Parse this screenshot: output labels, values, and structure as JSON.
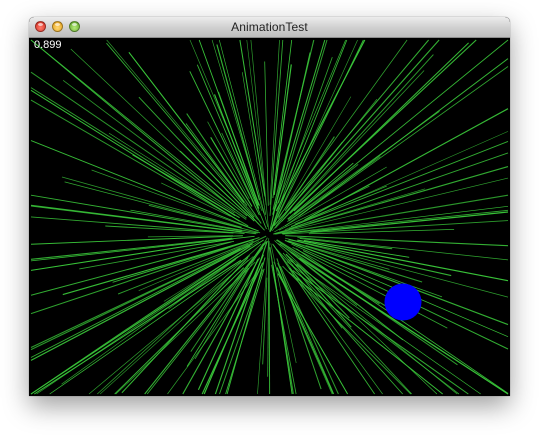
{
  "window": {
    "title": "AnimationTest",
    "controls": [
      "close",
      "minimize",
      "zoom"
    ]
  },
  "canvas": {
    "background": "#000000",
    "fps_readout": "0.899",
    "line_color": "#39c539",
    "ball_color": "#0000ff"
  }
}
